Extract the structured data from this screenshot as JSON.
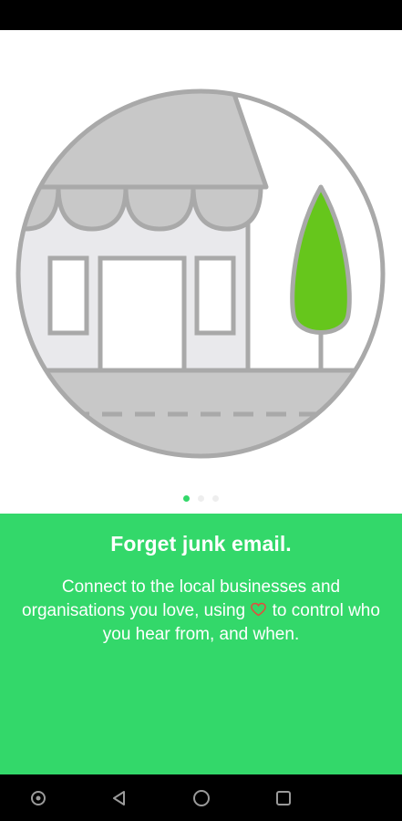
{
  "colors": {
    "accent": "#33d86a",
    "tree": "#66c61c",
    "illustration_outline": "#a9a9a9",
    "illustration_fill": "#c8c8c8",
    "illustration_wall": "#e9e9ec",
    "heart": "#e64a3c"
  },
  "illustration": {
    "name": "shopfront-illustration",
    "elements": [
      "awning",
      "shop-window-left",
      "shop-door",
      "shop-window-right",
      "tree",
      "road"
    ]
  },
  "pager": {
    "active_index": 0,
    "count": 3
  },
  "onboarding": {
    "headline": "Forget junk email.",
    "body_part1": "Connect to the local businesses and organisations you love, using ",
    "heart_icon": "heart-outline-icon",
    "body_part2": " to control who you hear from, and when."
  },
  "navigation_bar": {
    "buttons": [
      "accessibility-icon",
      "back-icon",
      "home-icon",
      "recents-icon"
    ]
  }
}
